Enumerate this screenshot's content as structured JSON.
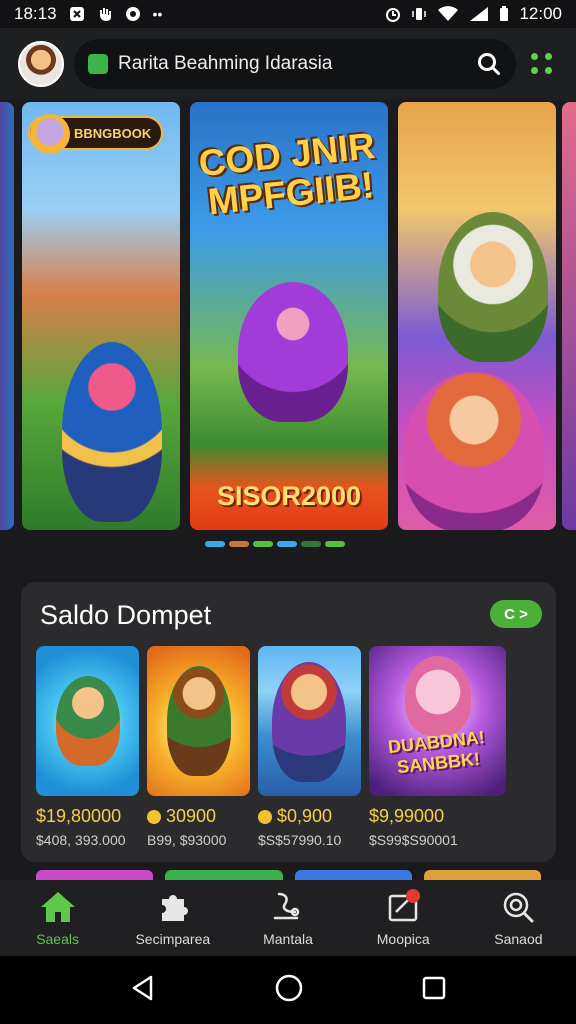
{
  "status_bar": {
    "time_left": "18:13",
    "time_right": "12:00"
  },
  "top_bar": {
    "search_text": "Rarita Beahming Idarasia"
  },
  "carousel": {
    "slide1_badge": "BBNGBOOK",
    "slide2_title": "COD JNIR MPFGIIB!",
    "slide2_price": "SISOR2000",
    "page_count": 6,
    "active_page": 0
  },
  "wallet": {
    "title": "Saldo Dompet",
    "toggle_label": "C >",
    "games": [
      {
        "price": "$19,80000",
        "sub": "$408, 393.000",
        "thumb_text": ""
      },
      {
        "price": "30900",
        "sub": "B99, $93000",
        "thumb_text": ""
      },
      {
        "price": "$0,900",
        "sub": "$S$57990.10",
        "thumb_text": ""
      },
      {
        "price": "$9,99000",
        "sub": "$S99$S90001",
        "thumb_text": "DUABDNA! SANBBK!"
      }
    ]
  },
  "bottom_nav": [
    {
      "label": "Saeals",
      "active": true
    },
    {
      "label": "Secimparea",
      "active": false
    },
    {
      "label": "Mantala",
      "active": false
    },
    {
      "label": "Moopica",
      "active": false
    },
    {
      "label": "Sanaod",
      "active": false
    }
  ],
  "colors": {
    "accent": "#5ec84a",
    "background": "#1a1a1c",
    "card": "#2b2b2e",
    "price": "#f3d04a"
  }
}
